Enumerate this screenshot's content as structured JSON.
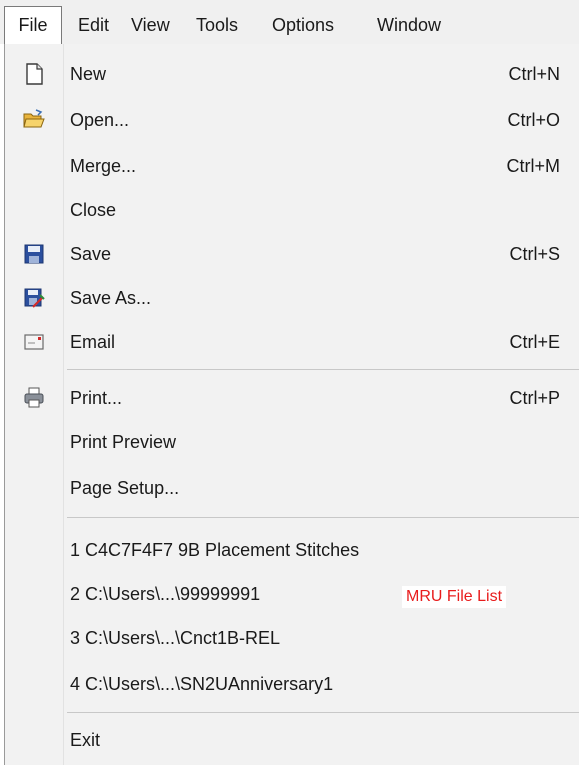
{
  "menubar": {
    "items": [
      "File",
      "Edit",
      "View",
      "Tools",
      "Options",
      "Window"
    ]
  },
  "file_menu": {
    "new": {
      "label": "New",
      "shortcut": "Ctrl+N"
    },
    "open": {
      "label": "Open...",
      "shortcut": "Ctrl+O"
    },
    "merge": {
      "label": "Merge...",
      "shortcut": "Ctrl+M"
    },
    "close": {
      "label": "Close"
    },
    "save": {
      "label": "Save",
      "shortcut": "Ctrl+S"
    },
    "save_as": {
      "label": "Save As..."
    },
    "email": {
      "label": "Email",
      "shortcut": "Ctrl+E"
    },
    "print": {
      "label": "Print...",
      "shortcut": "Ctrl+P"
    },
    "print_preview": {
      "label": "Print Preview"
    },
    "page_setup": {
      "label": "Page Setup..."
    },
    "mru": [
      "1 C4C7F4F7 9B Placement Stitches",
      "2 C:\\Users\\...\\99999991",
      "3 C:\\Users\\...\\Cnct1B-REL",
      "4 C:\\Users\\...\\SN2UAnniversary1"
    ],
    "exit": {
      "label": "Exit"
    }
  },
  "annotation": {
    "text": "MRU File List",
    "color": "#e81c1c"
  },
  "icons": {
    "new": "new-document-icon",
    "open": "open-folder-icon",
    "save": "floppy-disk-icon",
    "save_as": "save-as-icon",
    "email": "envelope-icon",
    "print": "printer-icon"
  }
}
